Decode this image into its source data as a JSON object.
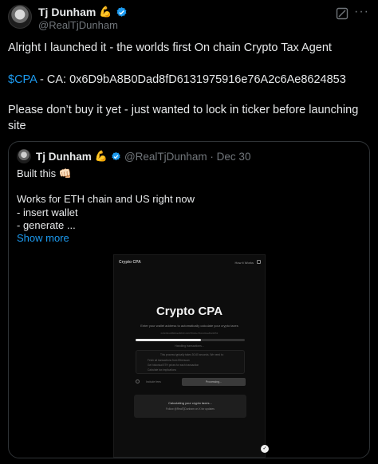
{
  "author": {
    "name": "Tj Dunham",
    "emoji": "💪",
    "handle": "@RealTjDunham"
  },
  "tweet": {
    "line1": "Alright I launched it - the worlds first On chain Crypto Tax Agent",
    "cashtag": "$CPA",
    "ca_text": " - CA: 0x6D9bA8B0Dad8fD6131975916e76A2c6Ae8624853",
    "line3a": "Please don’t buy it yet - just wanted to lock in ticker before launching",
    "line3b": "site"
  },
  "quote": {
    "name": "Tj Dunham",
    "emoji": "💪",
    "meta": "@RealTjDunham · Dec 30",
    "line1": "Built this 👊🏻",
    "line2": "Works for ETH chain and US right now",
    "line3": "- insert wallet",
    "line4": "- generate ...",
    "show_more": "Show more"
  },
  "image": {
    "brand": "Crypto CPA",
    "how": "How it Works",
    "title": "Crypto CPA",
    "subtitle": "Enter your wallet address to automatically calculate your crypto taxes",
    "address": "0x6D9bA8B0Dad8fD6131975916e76A2c6Ae8624853",
    "progress": 0.6,
    "step": "Handling transactions...",
    "box_lines": [
      "This process typically takes 30-60 seconds. We need to:",
      "Fetch all transactions from Etherscan",
      "Get historical ETH prices for each transaction",
      "Calculate tax implications"
    ],
    "include": "Include fees",
    "button": "Processing...",
    "status1": "Calculating your crypto taxes...",
    "status2": "Follow @RealTjDunham on X for updates"
  }
}
